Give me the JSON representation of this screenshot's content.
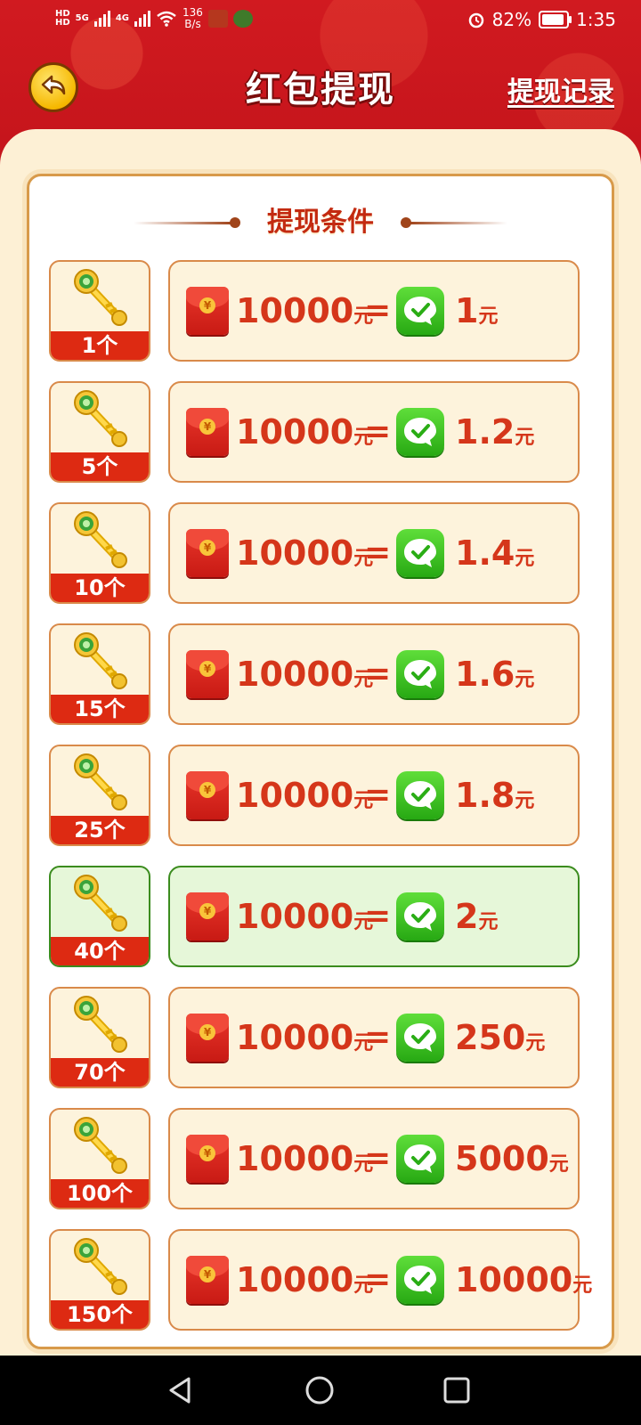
{
  "status_bar": {
    "hd1": "HD",
    "hd2": "HD",
    "net_5g": "5G",
    "net_4g": "4G",
    "speed_value": "136",
    "speed_unit": "B/s",
    "battery": "82%",
    "time": "1:35"
  },
  "header": {
    "title": "红包提现",
    "records_link": "提现记录"
  },
  "section": {
    "title": "提现条件"
  },
  "colors": {
    "header_red": "#c8161d",
    "panel_cream": "#fdf0d5",
    "card_border": "#d98a4a",
    "accent_text": "#d5361a",
    "active_green": "#e6f7d9",
    "wechat_green": "#27a913"
  },
  "rows": [
    {
      "keys": "1个",
      "amount": "10000",
      "amount_unit": "元",
      "eq": "=",
      "payout": "1",
      "payout_unit": "元",
      "active": false
    },
    {
      "keys": "5个",
      "amount": "10000",
      "amount_unit": "元",
      "eq": "=",
      "payout": "1.2",
      "payout_unit": "元",
      "active": false
    },
    {
      "keys": "10个",
      "amount": "10000",
      "amount_unit": "元",
      "eq": "=",
      "payout": "1.4",
      "payout_unit": "元",
      "active": false
    },
    {
      "keys": "15个",
      "amount": "10000",
      "amount_unit": "元",
      "eq": "=",
      "payout": "1.6",
      "payout_unit": "元",
      "active": false
    },
    {
      "keys": "25个",
      "amount": "10000",
      "amount_unit": "元",
      "eq": "=",
      "payout": "1.8",
      "payout_unit": "元",
      "active": false
    },
    {
      "keys": "40个",
      "amount": "10000",
      "amount_unit": "元",
      "eq": "=",
      "payout": "2",
      "payout_unit": "元",
      "active": true
    },
    {
      "keys": "70个",
      "amount": "10000",
      "amount_unit": "元",
      "eq": "=",
      "payout": "250",
      "payout_unit": "元",
      "active": false
    },
    {
      "keys": "100个",
      "amount": "10000",
      "amount_unit": "元",
      "eq": "=",
      "payout": "5000",
      "payout_unit": "元",
      "active": false
    },
    {
      "keys": "150个",
      "amount": "10000",
      "amount_unit": "元",
      "eq": "=",
      "payout": "10000",
      "payout_unit": "元",
      "active": false
    }
  ],
  "icons": {
    "back": "back-arrow-icon",
    "key": "key-icon",
    "red_packet": "red-packet-icon",
    "wechat": "wechat-icon",
    "nav_back": "nav-back-icon",
    "nav_home": "nav-home-icon",
    "nav_recents": "nav-recents-icon"
  }
}
